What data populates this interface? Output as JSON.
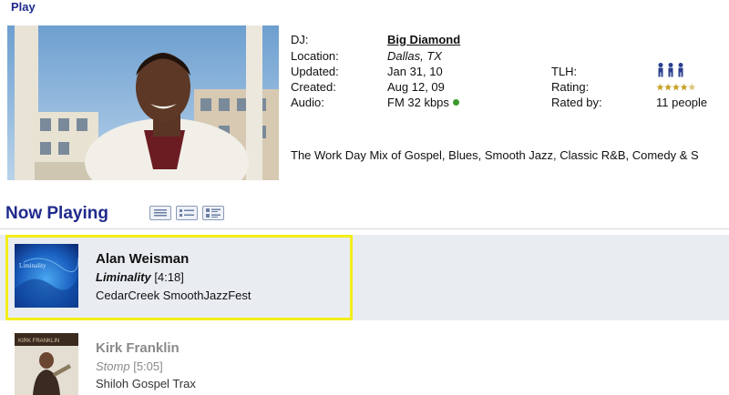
{
  "play_link": "Play",
  "dj": {
    "fields_left": [
      {
        "label": "DJ:",
        "value": "Big Diamond"
      },
      {
        "label": "Location:",
        "value": "Dallas, TX"
      },
      {
        "label": "Updated:",
        "value": "Jan 31, 10"
      },
      {
        "label": "Created:",
        "value": "Aug 12, 09"
      },
      {
        "label": "Audio:",
        "value": "FM 32 kbps"
      }
    ],
    "fields_right": [
      {
        "label": "TLH:"
      },
      {
        "label": "Rating:"
      },
      {
        "label": "Rated by:",
        "value": "11 people"
      }
    ],
    "rating_stars": 4.5,
    "tlh_icon": "listeners-icon",
    "audio_status_color": "#3a9b2a",
    "description": "The Work Day Mix of Gospel, Blues, Smooth Jazz, Classic R&B, Comedy & S"
  },
  "now_playing": {
    "title": "Now Playing",
    "view_icons": [
      "list-view-icon",
      "compact-view-icon",
      "detail-view-icon"
    ],
    "tracks": [
      {
        "artist": "Alan Weisman",
        "song": "Liminality",
        "duration": "[4:18]",
        "album": "CedarCreek SmoothJazzFest",
        "cover_text": "Liminality"
      },
      {
        "artist": "Kirk Franklin",
        "song": "Stomp",
        "duration": "[5:05]",
        "album": "Shiloh Gospel Trax",
        "cover_text": "KIRK FRANKLIN"
      }
    ]
  },
  "colors": {
    "accent": "#1f2a8c",
    "highlight": "#f2ee1a",
    "row_bg": "#e9ecf1",
    "star": "#c8a227"
  }
}
